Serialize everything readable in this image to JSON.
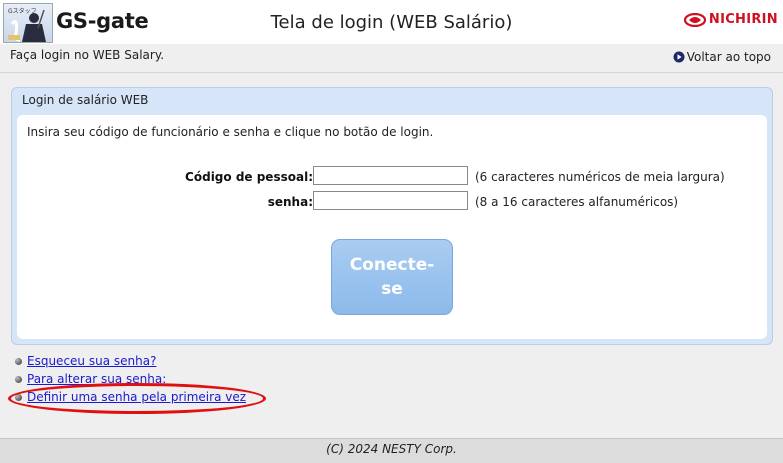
{
  "header": {
    "logo_name": "GS-gate",
    "logo_caption": "Gスタッフ",
    "title": "Tela de login (WEB Salário)",
    "brand": "NICHIRIN"
  },
  "subbar": {
    "message": "Faça login no WEB Salary.",
    "back_to_top": "Voltar ao topo"
  },
  "panel": {
    "heading": "Login de salário WEB",
    "instructions": "Insira seu código de funcionário e senha e clique no botão de login.",
    "fields": [
      {
        "label": "Código de pessoal:",
        "value": "",
        "hint": "(6 caracteres numéricos de meia largura)"
      },
      {
        "label": "senha:",
        "value": "",
        "hint": "(8 a 16 caracteres alfanuméricos)"
      }
    ],
    "login_button": {
      "line1": "Conecte-",
      "line2": "se"
    }
  },
  "links": [
    {
      "label": "Esqueceu sua senha?"
    },
    {
      "label": "Para alterar sua senha:"
    },
    {
      "label": "Definir uma senha pela primeira vez",
      "highlighted": true
    }
  ],
  "colors": {
    "panel_bg": "#d7e5f8",
    "button_bg": "#a9cdf2",
    "link": "#1a1ad0",
    "highlight": "#e01010",
    "brand": "#d01020"
  },
  "footer": {
    "copyright": "(C) 2024 NESTY Corp."
  }
}
